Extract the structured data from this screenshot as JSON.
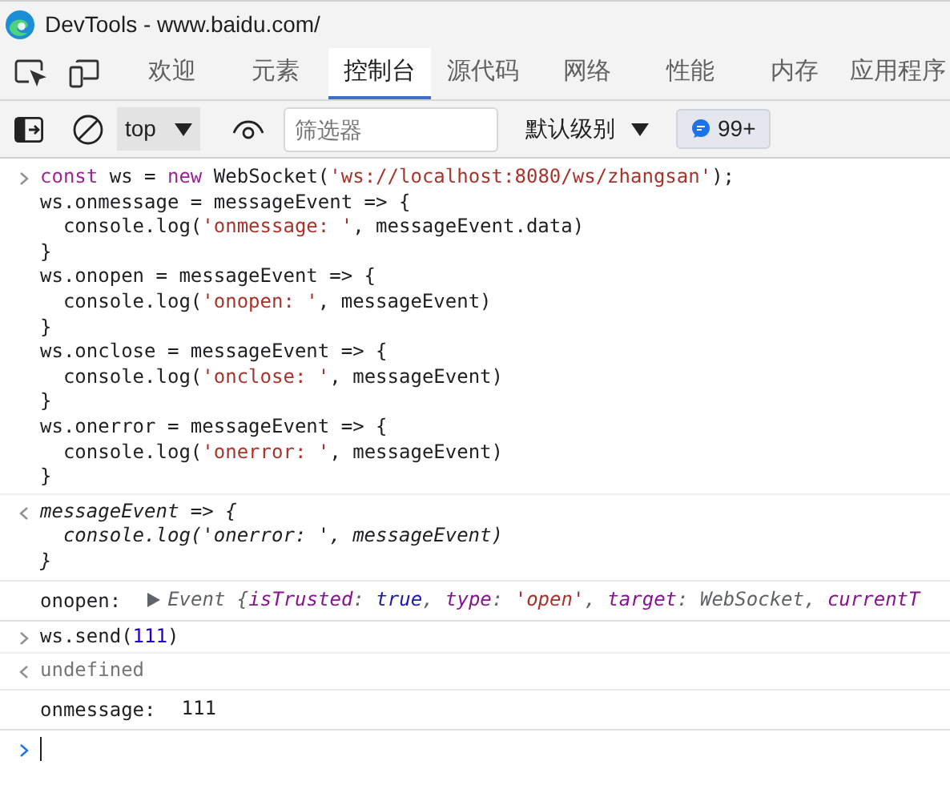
{
  "window": {
    "title": "DevTools - www.baidu.com/"
  },
  "tabs": [
    {
      "label": "欢迎",
      "selected": false
    },
    {
      "label": "元素",
      "selected": false
    },
    {
      "label": "控制台",
      "selected": true
    },
    {
      "label": "源代码",
      "selected": false
    },
    {
      "label": "网络",
      "selected": false
    },
    {
      "label": "性能",
      "selected": false
    },
    {
      "label": "内存",
      "selected": false
    },
    {
      "label": "应用程序",
      "selected": false
    }
  ],
  "toolbar": {
    "context": "top",
    "filter": {
      "placeholder": "筛选器"
    },
    "levels": "默认级别",
    "issues": "99+"
  },
  "console": [
    {
      "kind": "input",
      "lines": [
        [
          {
            "kind": "keyword",
            "text": "const"
          },
          {
            "kind": "plain",
            "text": " ws = "
          },
          {
            "kind": "keyword",
            "text": "new"
          },
          {
            "kind": "plain",
            "text": " WebSocket("
          },
          {
            "kind": "string",
            "text": "'ws://localhost:8080/ws/zhangsan'"
          },
          {
            "kind": "plain",
            "text": ");"
          }
        ],
        [
          {
            "kind": "plain",
            "text": "ws.onmessage = messageEvent => {"
          }
        ],
        [
          {
            "kind": "plain",
            "text": "  console.log("
          },
          {
            "kind": "string",
            "text": "'onmessage: '"
          },
          {
            "kind": "plain",
            "text": ", messageEvent.data)"
          }
        ],
        [
          {
            "kind": "plain",
            "text": "}"
          }
        ],
        [
          {
            "kind": "plain",
            "text": "ws.onopen = messageEvent => {"
          }
        ],
        [
          {
            "kind": "plain",
            "text": "  console.log("
          },
          {
            "kind": "string",
            "text": "'onopen: '"
          },
          {
            "kind": "plain",
            "text": ", messageEvent)"
          }
        ],
        [
          {
            "kind": "plain",
            "text": "}"
          }
        ],
        [
          {
            "kind": "plain",
            "text": "ws.onclose = messageEvent => {"
          }
        ],
        [
          {
            "kind": "plain",
            "text": "  console.log("
          },
          {
            "kind": "string",
            "text": "'onclose: '"
          },
          {
            "kind": "plain",
            "text": ", messageEvent)"
          }
        ],
        [
          {
            "kind": "plain",
            "text": "}"
          }
        ],
        [
          {
            "kind": "plain",
            "text": "ws.onerror = messageEvent => {"
          }
        ],
        [
          {
            "kind": "plain",
            "text": "  console.log("
          },
          {
            "kind": "string",
            "text": "'onerror: '"
          },
          {
            "kind": "plain",
            "text": ", messageEvent)"
          }
        ],
        [
          {
            "kind": "plain",
            "text": "}"
          }
        ]
      ]
    },
    {
      "kind": "function_result",
      "lines": [
        [
          {
            "kind": "plain",
            "text": "messageEvent => {"
          }
        ],
        [
          {
            "kind": "plain",
            "text": "  console.log('onerror: ', messageEvent)"
          }
        ],
        [
          {
            "kind": "plain",
            "text": "}"
          }
        ]
      ]
    },
    {
      "kind": "log",
      "label": "onopen:",
      "expandable": true,
      "lines": [
        [
          {
            "kind": "obj",
            "text": "Event {"
          },
          {
            "kind": "prop",
            "text": "isTrusted"
          },
          {
            "kind": "obj",
            "text": ": "
          },
          {
            "kind": "bool",
            "text": "true"
          },
          {
            "kind": "obj",
            "text": ", "
          },
          {
            "kind": "prop",
            "text": "type"
          },
          {
            "kind": "obj",
            "text": ": "
          },
          {
            "kind": "ostring",
            "text": "'open'"
          },
          {
            "kind": "obj",
            "text": ", "
          },
          {
            "kind": "prop",
            "text": "target"
          },
          {
            "kind": "obj",
            "text": ": WebSocket, "
          },
          {
            "kind": "prop",
            "text": "currentT"
          }
        ]
      ]
    },
    {
      "kind": "input",
      "lines": [
        [
          {
            "kind": "plain",
            "text": "ws.send("
          },
          {
            "kind": "number",
            "text": "111"
          },
          {
            "kind": "plain",
            "text": ")"
          }
        ]
      ]
    },
    {
      "kind": "value_result",
      "lines": [
        [
          {
            "kind": "undefined",
            "text": "undefined"
          }
        ]
      ]
    },
    {
      "kind": "log",
      "label": "onmessage:",
      "expandable": false,
      "lines": [
        [
          {
            "kind": "plain",
            "text": "111"
          }
        ]
      ]
    },
    {
      "kind": "prompt"
    }
  ]
}
